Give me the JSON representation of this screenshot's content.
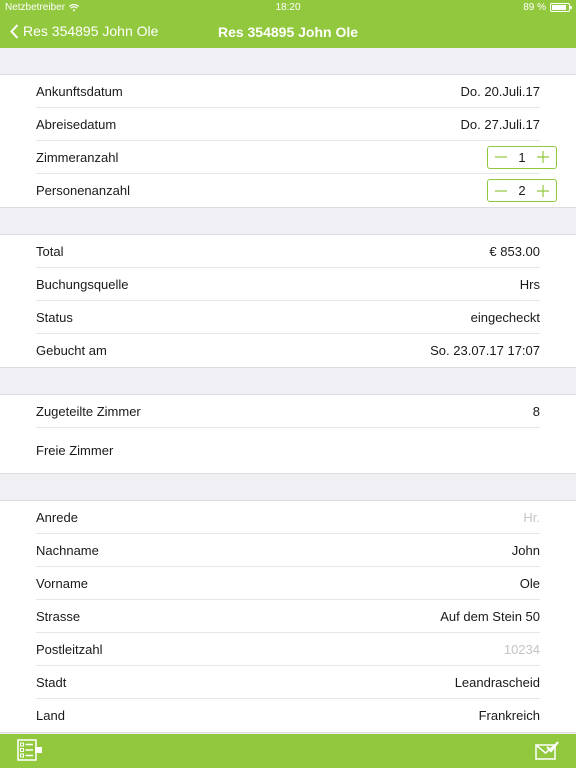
{
  "status_bar": {
    "carrier": "Netzbetreiber",
    "time": "18:20",
    "battery": "89 %",
    "battery_level": 0.89
  },
  "nav": {
    "back_label": "Res 354895 John Ole",
    "title": "Res 354895 John Ole"
  },
  "dates": {
    "arrival_label": "Ankunftsdatum",
    "arrival_value": "Do. 20.Juli.17",
    "departure_label": "Abreisedatum",
    "departure_value": "Do. 27.Juli.17",
    "rooms_label": "Zimmeranzahl",
    "rooms_value": "1",
    "persons_label": "Personenanzahl",
    "persons_value": "2"
  },
  "booking": {
    "total_label": "Total",
    "total_value": "€ 853.00",
    "source_label": "Buchungsquelle",
    "source_value": "Hrs",
    "status_label": "Status",
    "status_value": "eingecheckt",
    "booked_label": "Gebucht am",
    "booked_value": "So. 23.07.17 17:07"
  },
  "rooms": {
    "assigned_label": "Zugeteilte Zimmer",
    "assigned_value": "8",
    "free_label": "Freie Zimmer"
  },
  "guest": {
    "salutation_label": "Anrede",
    "salutation_placeholder": "Hr.",
    "lastname_label": "Nachname",
    "lastname_value": "John",
    "firstname_label": "Vorname",
    "firstname_value": "Ole",
    "street_label": "Strasse",
    "street_value": "Auf dem Stein 50",
    "zip_label": "Postleitzahl",
    "zip_placeholder": "10234",
    "city_label": "Stadt",
    "city_value": "Leandrascheid",
    "country_label": "Land",
    "country_value": "Frankreich"
  },
  "toolbar": {
    "left_icon": "list-form-icon",
    "right_icon": "mail-check-icon"
  },
  "colors": {
    "accent": "#92c83e",
    "background": "#efeff4"
  }
}
